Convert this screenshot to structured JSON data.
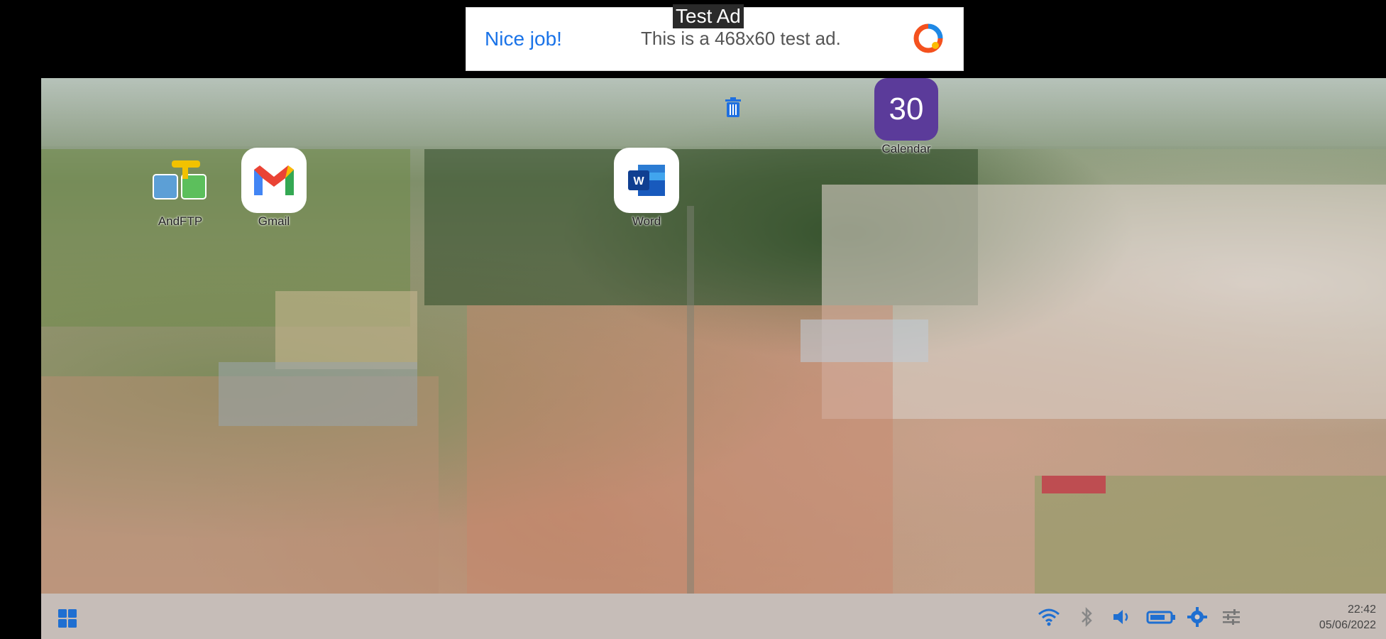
{
  "ad": {
    "tag": "Test Ad",
    "left_text": "Nice job!",
    "body_text": "This is a 468x60 test ad."
  },
  "desktop": {
    "icons": [
      {
        "label": "AndFTP",
        "icon": "andftp-icon"
      },
      {
        "label": "Gmail",
        "icon": "gmail-icon"
      },
      {
        "label": "Word",
        "icon": "word-icon"
      },
      {
        "label": "Calendar",
        "icon": "calendar-icon",
        "number": "30"
      }
    ],
    "trash_icon": "trash-icon"
  },
  "taskbar": {
    "start_icon": "windows-start-icon",
    "tray": [
      "wifi-icon",
      "bluetooth-icon",
      "volume-icon",
      "battery-icon",
      "settings-icon",
      "sliders-icon"
    ],
    "time": "22:42",
    "date": "05/06/2022"
  },
  "colors": {
    "accent_blue": "#1a73e8",
    "calendar_purple": "#5b3b9a",
    "tray_blue": "#1f6fd1"
  }
}
